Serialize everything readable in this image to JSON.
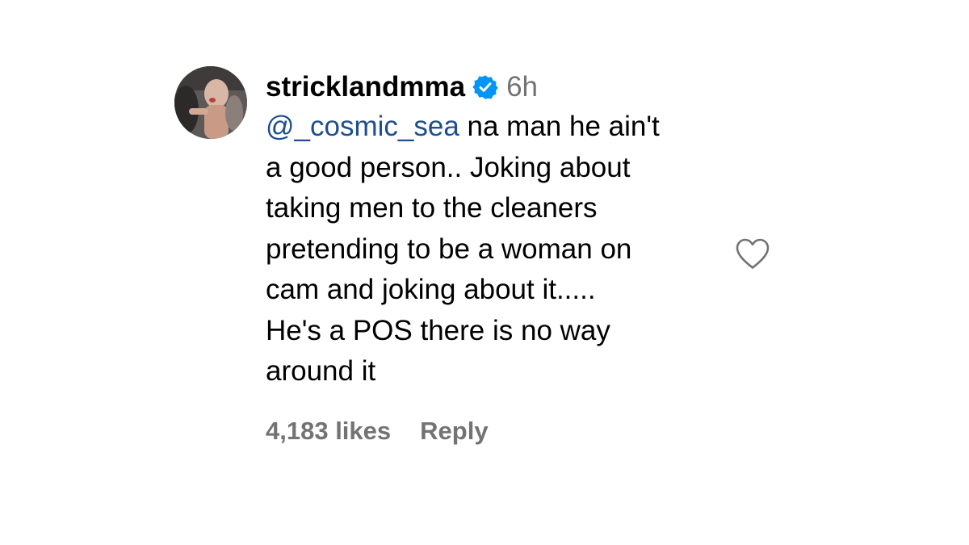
{
  "comment": {
    "avatar_icon": "profile-photo",
    "username": "stricklandmma",
    "verified_icon": "verified-badge-icon",
    "time": "6h",
    "mention": "@_cosmic_sea",
    "text_lines": [
      " na man he ain't",
      "a good person.. Joking about",
      "taking men to the cleaners",
      "pretending to be a woman on",
      "cam and joking about it.....",
      "He's a POS there is no way",
      "around it"
    ],
    "likes": "4,183 likes",
    "reply_label": "Reply",
    "like_icon": "heart-outline-icon"
  },
  "colors": {
    "text": "#000000",
    "secondary": "#737373",
    "mention": "#1f4e8f",
    "verified": "#0095f6"
  }
}
